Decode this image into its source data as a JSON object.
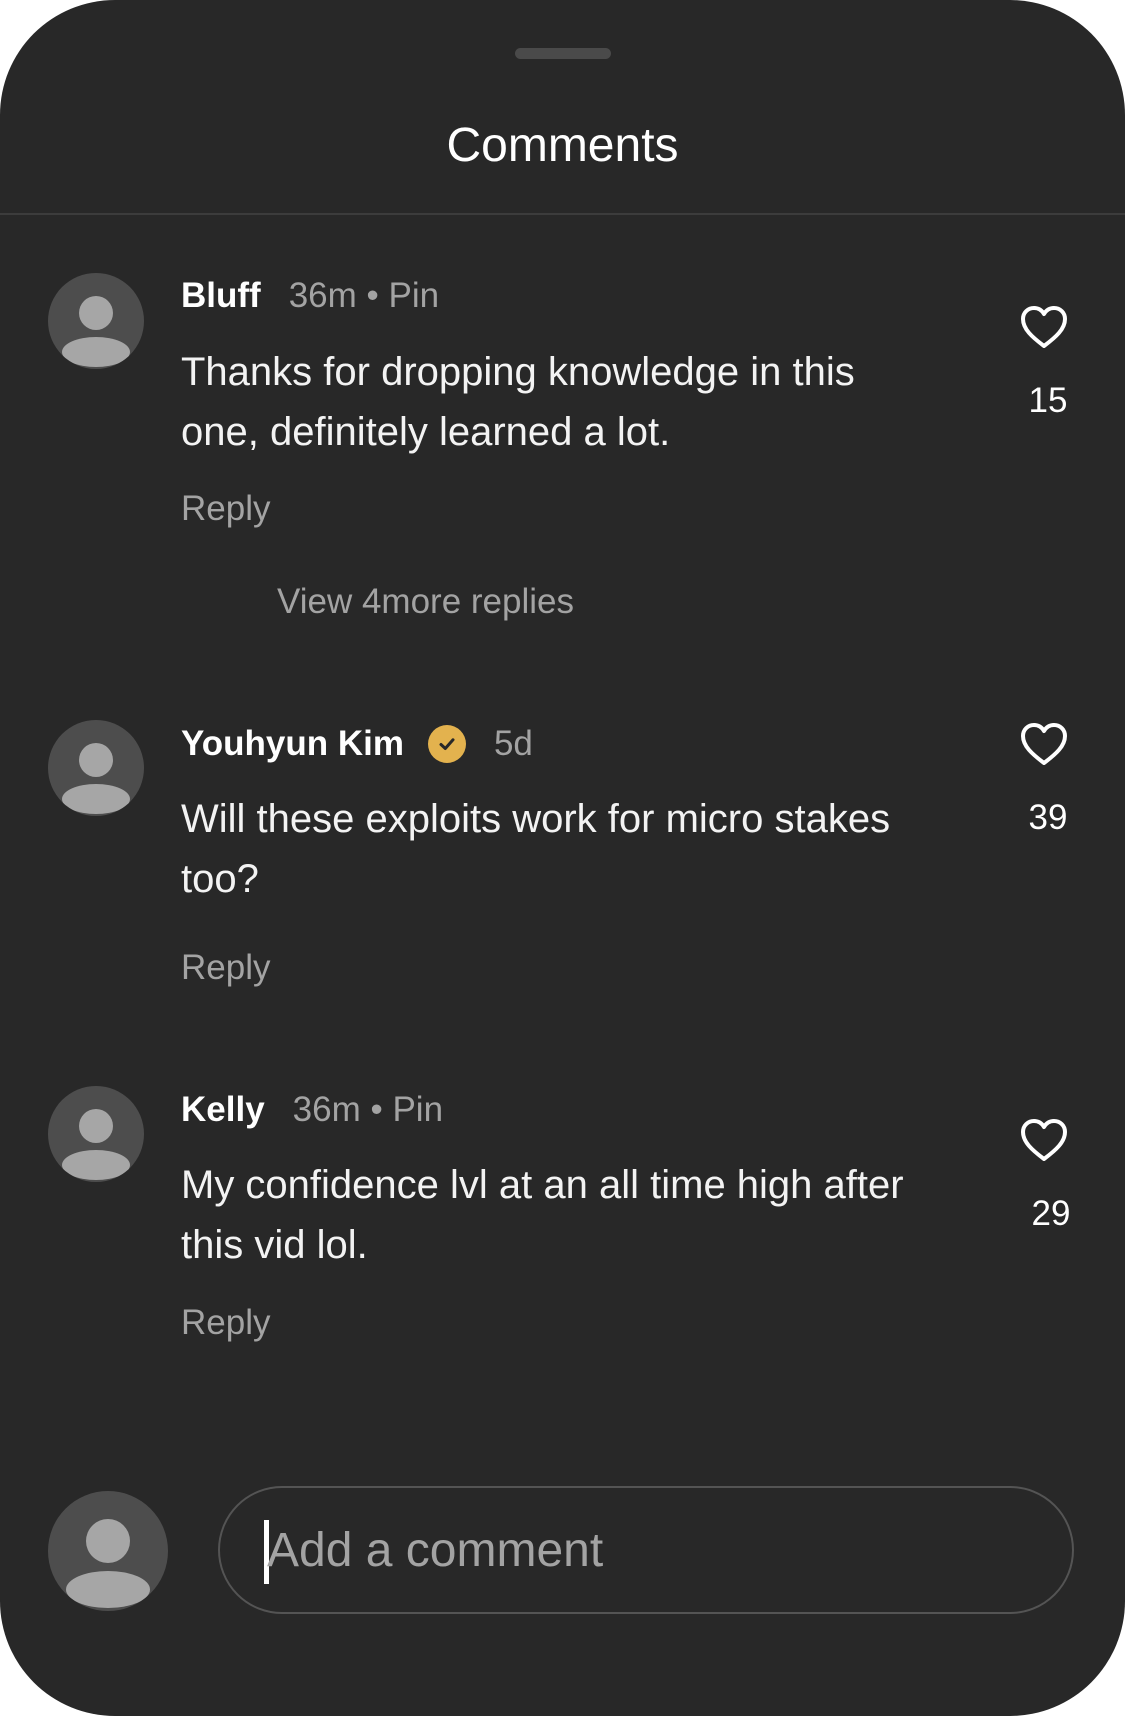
{
  "header": {
    "title": "Comments"
  },
  "comments": [
    {
      "author": "Bluff",
      "time": "36m • Pin",
      "text": "Thanks for dropping knowledge in this one, definitely learned a lot.",
      "reply_label": "Reply",
      "view_more_label": "View 4more replies",
      "likes": "15",
      "verified": false
    },
    {
      "author": "Youhyun Kim",
      "time": "5d",
      "text": "Will these exploits work for micro stakes too?",
      "reply_label": "Reply",
      "likes": "39",
      "verified": true
    },
    {
      "author": "Kelly",
      "time": "36m • Pin",
      "text": "My confidence lvl at an all time high after this vid lol.",
      "reply_label": "Reply",
      "likes": "29",
      "verified": false
    }
  ],
  "composer": {
    "placeholder": "Add a comment",
    "value": ""
  },
  "icons": {
    "avatar": "user-placeholder-icon",
    "like": "heart-outline-icon",
    "verified": "verified-check-icon"
  },
  "colors": {
    "background": "#282828",
    "verified_badge": "#e3b24e",
    "muted_text": "#a3a3a3"
  }
}
